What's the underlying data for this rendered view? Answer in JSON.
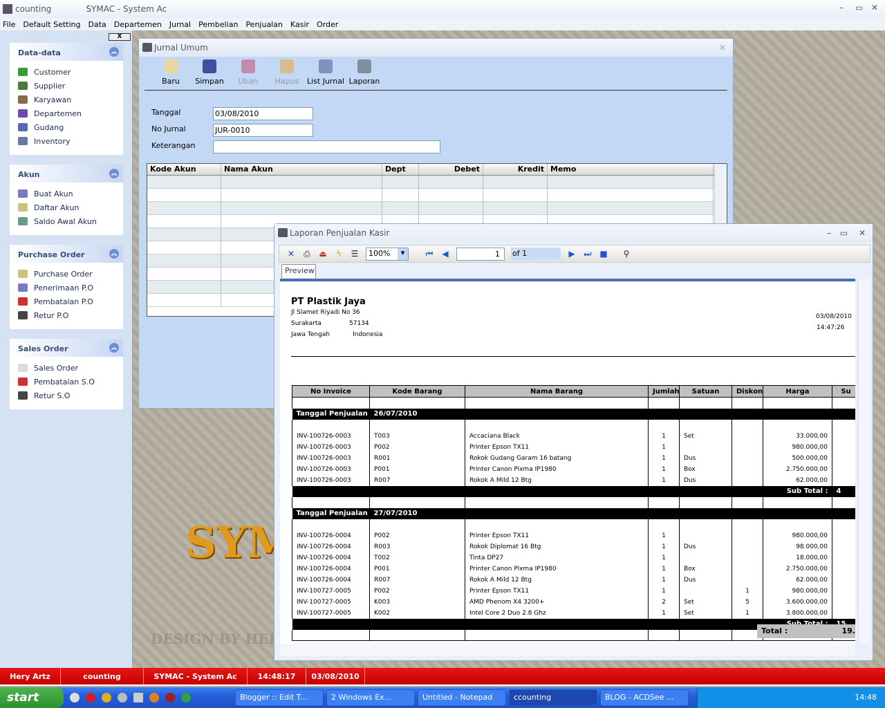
{
  "app": {
    "title": "counting",
    "subtitle": "SYMAC - System Ac"
  },
  "menu": [
    "File",
    "Default Setting",
    "Data",
    "Departemen",
    "Jurnal",
    "Pembelian",
    "Penjualan",
    "Kasir",
    "Order"
  ],
  "sidebar": {
    "close_label": "X",
    "panels": [
      {
        "title": "Data-data",
        "items": [
          {
            "label": "Customer",
            "color": "#3a9a3a"
          },
          {
            "label": "Supplier",
            "color": "#4a7a3a"
          },
          {
            "label": "Karyawan",
            "color": "#8a6a4a"
          },
          {
            "label": "Departemen",
            "color": "#6a4ab0"
          },
          {
            "label": "Gudang",
            "color": "#5a6ab0"
          },
          {
            "label": "Inventory",
            "color": "#6a7a9a"
          }
        ]
      },
      {
        "title": "Akun",
        "items": [
          {
            "label": "Buat Akun",
            "color": "#7a7ac0"
          },
          {
            "label": "Daftar Akun",
            "color": "#d0c080"
          },
          {
            "label": "Saldo Awal Akun",
            "color": "#6a9a8a"
          }
        ]
      },
      {
        "title": "Purchase Order",
        "items": [
          {
            "label": "Purchase Order",
            "color": "#d0c080"
          },
          {
            "label": "Penerimaan P.O",
            "color": "#7a7ac0"
          },
          {
            "label": "Pembatalan P.O",
            "color": "#d03030"
          },
          {
            "label": "Retur P.O",
            "color": "#444"
          }
        ]
      },
      {
        "title": "Sales Order",
        "items": [
          {
            "label": "Sales Order",
            "color": "#ddd"
          },
          {
            "label": "Pembatalan S.O",
            "color": "#d03030"
          },
          {
            "label": "Retur S.O",
            "color": "#444"
          }
        ]
      }
    ]
  },
  "background": {
    "logo": "SYM",
    "credit": "DESIGN BY HERY T"
  },
  "jurnal": {
    "title": "Jurnal Umum",
    "toolbar": [
      {
        "label": "Baru",
        "enabled": true,
        "color": "#e8d8a0"
      },
      {
        "label": "Simpan",
        "enabled": true,
        "color": "#4050a0"
      },
      {
        "label": "Ubah",
        "enabled": false,
        "color": "#c04060"
      },
      {
        "label": "Hapus",
        "enabled": false,
        "color": "#f0a020"
      },
      {
        "label": "List Jurnal",
        "enabled": true,
        "color": "#8090c0"
      },
      {
        "label": "Laporan",
        "enabled": true,
        "color": "#8090a0"
      }
    ],
    "fields": {
      "tanggal_label": "Tanggal",
      "tanggal": "03/08/2010",
      "nojurnal_label": "No Jurnal",
      "nojurnal": "JUR-0010",
      "keterangan_label": "Keterangan",
      "keterangan": ""
    },
    "columns": [
      "Kode Akun",
      "Nama Akun",
      "Dept",
      "Debet",
      "Kredit",
      "Memo"
    ]
  },
  "laporan": {
    "title": "Laporan Penjualan Kasir",
    "zoom": "100%",
    "page": "1",
    "page_of": "of 1",
    "tab": "Preview",
    "company": {
      "name": "PT Plastik Jaya",
      "address": "Jl Slamet Riyadi No 36",
      "city": "Surakarta",
      "zip": "57134",
      "province": "Jawa Tengah",
      "country": "Indonesia",
      "date": "03/08/2010",
      "time": "14:47:26"
    },
    "columns": [
      "No Invoice",
      "Kode Barang",
      "Nama Barang",
      "Jumlah",
      "Satuan",
      "Diskon",
      "Harga",
      "Su"
    ],
    "group_label": "Tanggal Penjualan :",
    "subtotal_label": "Sub Total :",
    "total_label": "Total :",
    "total_value": "19.",
    "groups": [
      {
        "date": "26/07/2010",
        "subtotal": "4",
        "rows": [
          [
            "INV-100726-0003",
            "T003",
            "Accaciana Black",
            "1",
            "Set",
            "",
            "33.000,00"
          ],
          [
            "INV-100726-0003",
            "P002",
            "Printer Epson TX11",
            "1",
            "",
            "",
            "980.000,00"
          ],
          [
            "INV-100726-0003",
            "R001",
            "Rokok Gudang Garam 16 batang",
            "1",
            "Dus",
            "",
            "500.000,00"
          ],
          [
            "INV-100726-0003",
            "P001",
            "Printer Canon Pixma IP1980",
            "1",
            "Box",
            "",
            "2.750.000,00"
          ],
          [
            "INV-100726-0003",
            "R007",
            "Rokok A Mild 12 Btg",
            "1",
            "Dus",
            "",
            "62.000,00"
          ]
        ]
      },
      {
        "date": "27/07/2010",
        "subtotal": "15",
        "rows": [
          [
            "INV-100726-0004",
            "P002",
            "Printer Epson TX11",
            "1",
            "",
            "",
            "980.000,00"
          ],
          [
            "INV-100726-0004",
            "R003",
            "Rokok Diplomat 16 Btg",
            "1",
            "Dus",
            "",
            "98.000,00"
          ],
          [
            "INV-100726-0004",
            "T002",
            "Tinta DP27",
            "1",
            "",
            "",
            "18.000,00"
          ],
          [
            "INV-100726-0004",
            "P001",
            "Printer Canon Pixma IP1980",
            "1",
            "Box",
            "",
            "2.750.000,00"
          ],
          [
            "INV-100726-0004",
            "R007",
            "Rokok A Mild 12 Btg",
            "1",
            "Dus",
            "",
            "62.000,00"
          ],
          [
            "INV-100727-0005",
            "P002",
            "Printer Epson TX11",
            "1",
            "",
            "1",
            "980.000,00"
          ],
          [
            "INV-100727-0005",
            "K003",
            "AMD Phenom X4 3200+",
            "2",
            "Set",
            "5",
            "3.600.000,00"
          ],
          [
            "INV-100727-0005",
            "K002",
            "Intel Core 2 Duo 2.8 Ghz",
            "1",
            "Set",
            "1",
            "3.800.000,00"
          ]
        ]
      }
    ]
  },
  "statusbar": [
    "Hery Artz",
    "counting",
    "SYMAC - System Ac",
    "14:48:17",
    "03/08/2010"
  ],
  "taskbar": {
    "start": "start",
    "tasks": [
      "Blogger :: Edit T...",
      "2 Windows Ex...",
      "Untitled - Notepad",
      "ccounting",
      "BLOG - ACDSee ..."
    ],
    "clock": "14:48"
  }
}
